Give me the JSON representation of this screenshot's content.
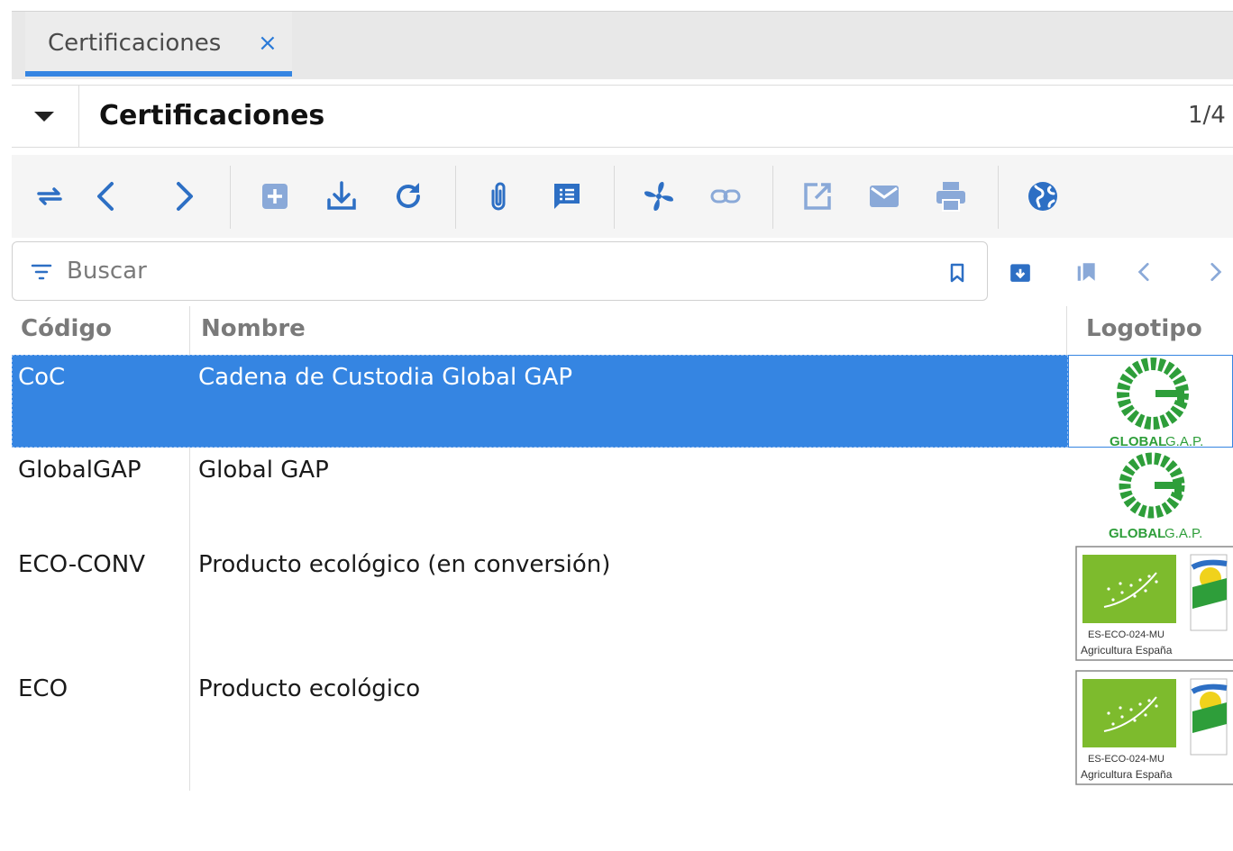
{
  "tabs": [
    {
      "label": "Certificaciones",
      "close": "×"
    }
  ],
  "form": {
    "title": "Certificaciones",
    "record_count": "1/4"
  },
  "toolbar": {
    "buttons": [
      "switch-view-icon",
      "previous-record-icon",
      "next-record-icon",
      "new-record-icon",
      "save-icon",
      "reload-icon",
      "attachment-icon",
      "note-icon",
      "action-icon",
      "relate-icon",
      "open-report-icon",
      "email-icon",
      "print-icon",
      "web-link-icon"
    ]
  },
  "search": {
    "placeholder": "Buscar",
    "value": ""
  },
  "table": {
    "columns": [
      "Código",
      "Nombre",
      "Logotipo"
    ],
    "rows": [
      {
        "code": "CoC",
        "name": "Cadena de Custodia Global GAP",
        "logo": "globalgap",
        "selected": true
      },
      {
        "code": "GlobalGAP",
        "name": "Global GAP",
        "logo": "globalgap",
        "selected": false
      },
      {
        "code": "ECO-CONV",
        "name": "Producto ecológico (en conversión)",
        "logo": "eu-organic",
        "selected": false
      },
      {
        "code": "ECO",
        "name": "Producto ecológico",
        "logo": "eu-organic",
        "selected": false
      }
    ]
  },
  "logos": {
    "globalgap": {
      "text_bold": "GLOBAL",
      "text_light": "G.A.P.",
      "color": "#2e9e3a"
    },
    "eu_organic": {
      "code": "ES-ECO-024-MU",
      "caption": "Agricultura España",
      "color": "#7dbb2d"
    }
  },
  "colors": {
    "accent": "#3585e2",
    "icon": "#2d6fc4",
    "icon_muted": "#8aa9d8"
  }
}
